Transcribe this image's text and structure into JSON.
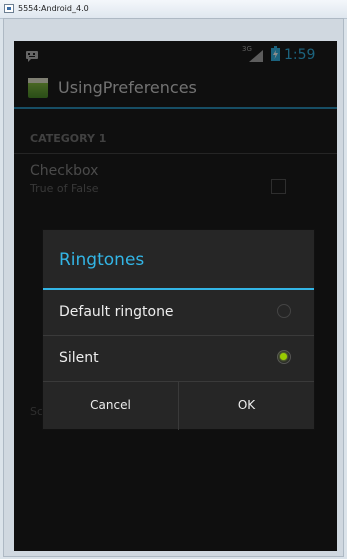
{
  "window": {
    "title": "5554:Android_4.0"
  },
  "status_bar": {
    "network_type": "3G",
    "time": "1:59"
  },
  "action_bar": {
    "title": "UsingPreferences"
  },
  "preferences": {
    "category": "CATEGORY 1",
    "checkbox_title": "Checkbox",
    "checkbox_summary": "True of False",
    "bottom_item": "Screen"
  },
  "dialog": {
    "title": "Ringtones",
    "options": [
      {
        "label": "Default ringtone",
        "selected": false
      },
      {
        "label": "Silent",
        "selected": true
      }
    ],
    "cancel_label": "Cancel",
    "ok_label": "OK"
  },
  "colors": {
    "accent": "#33b5e5",
    "radio_on": "#99cc00"
  }
}
